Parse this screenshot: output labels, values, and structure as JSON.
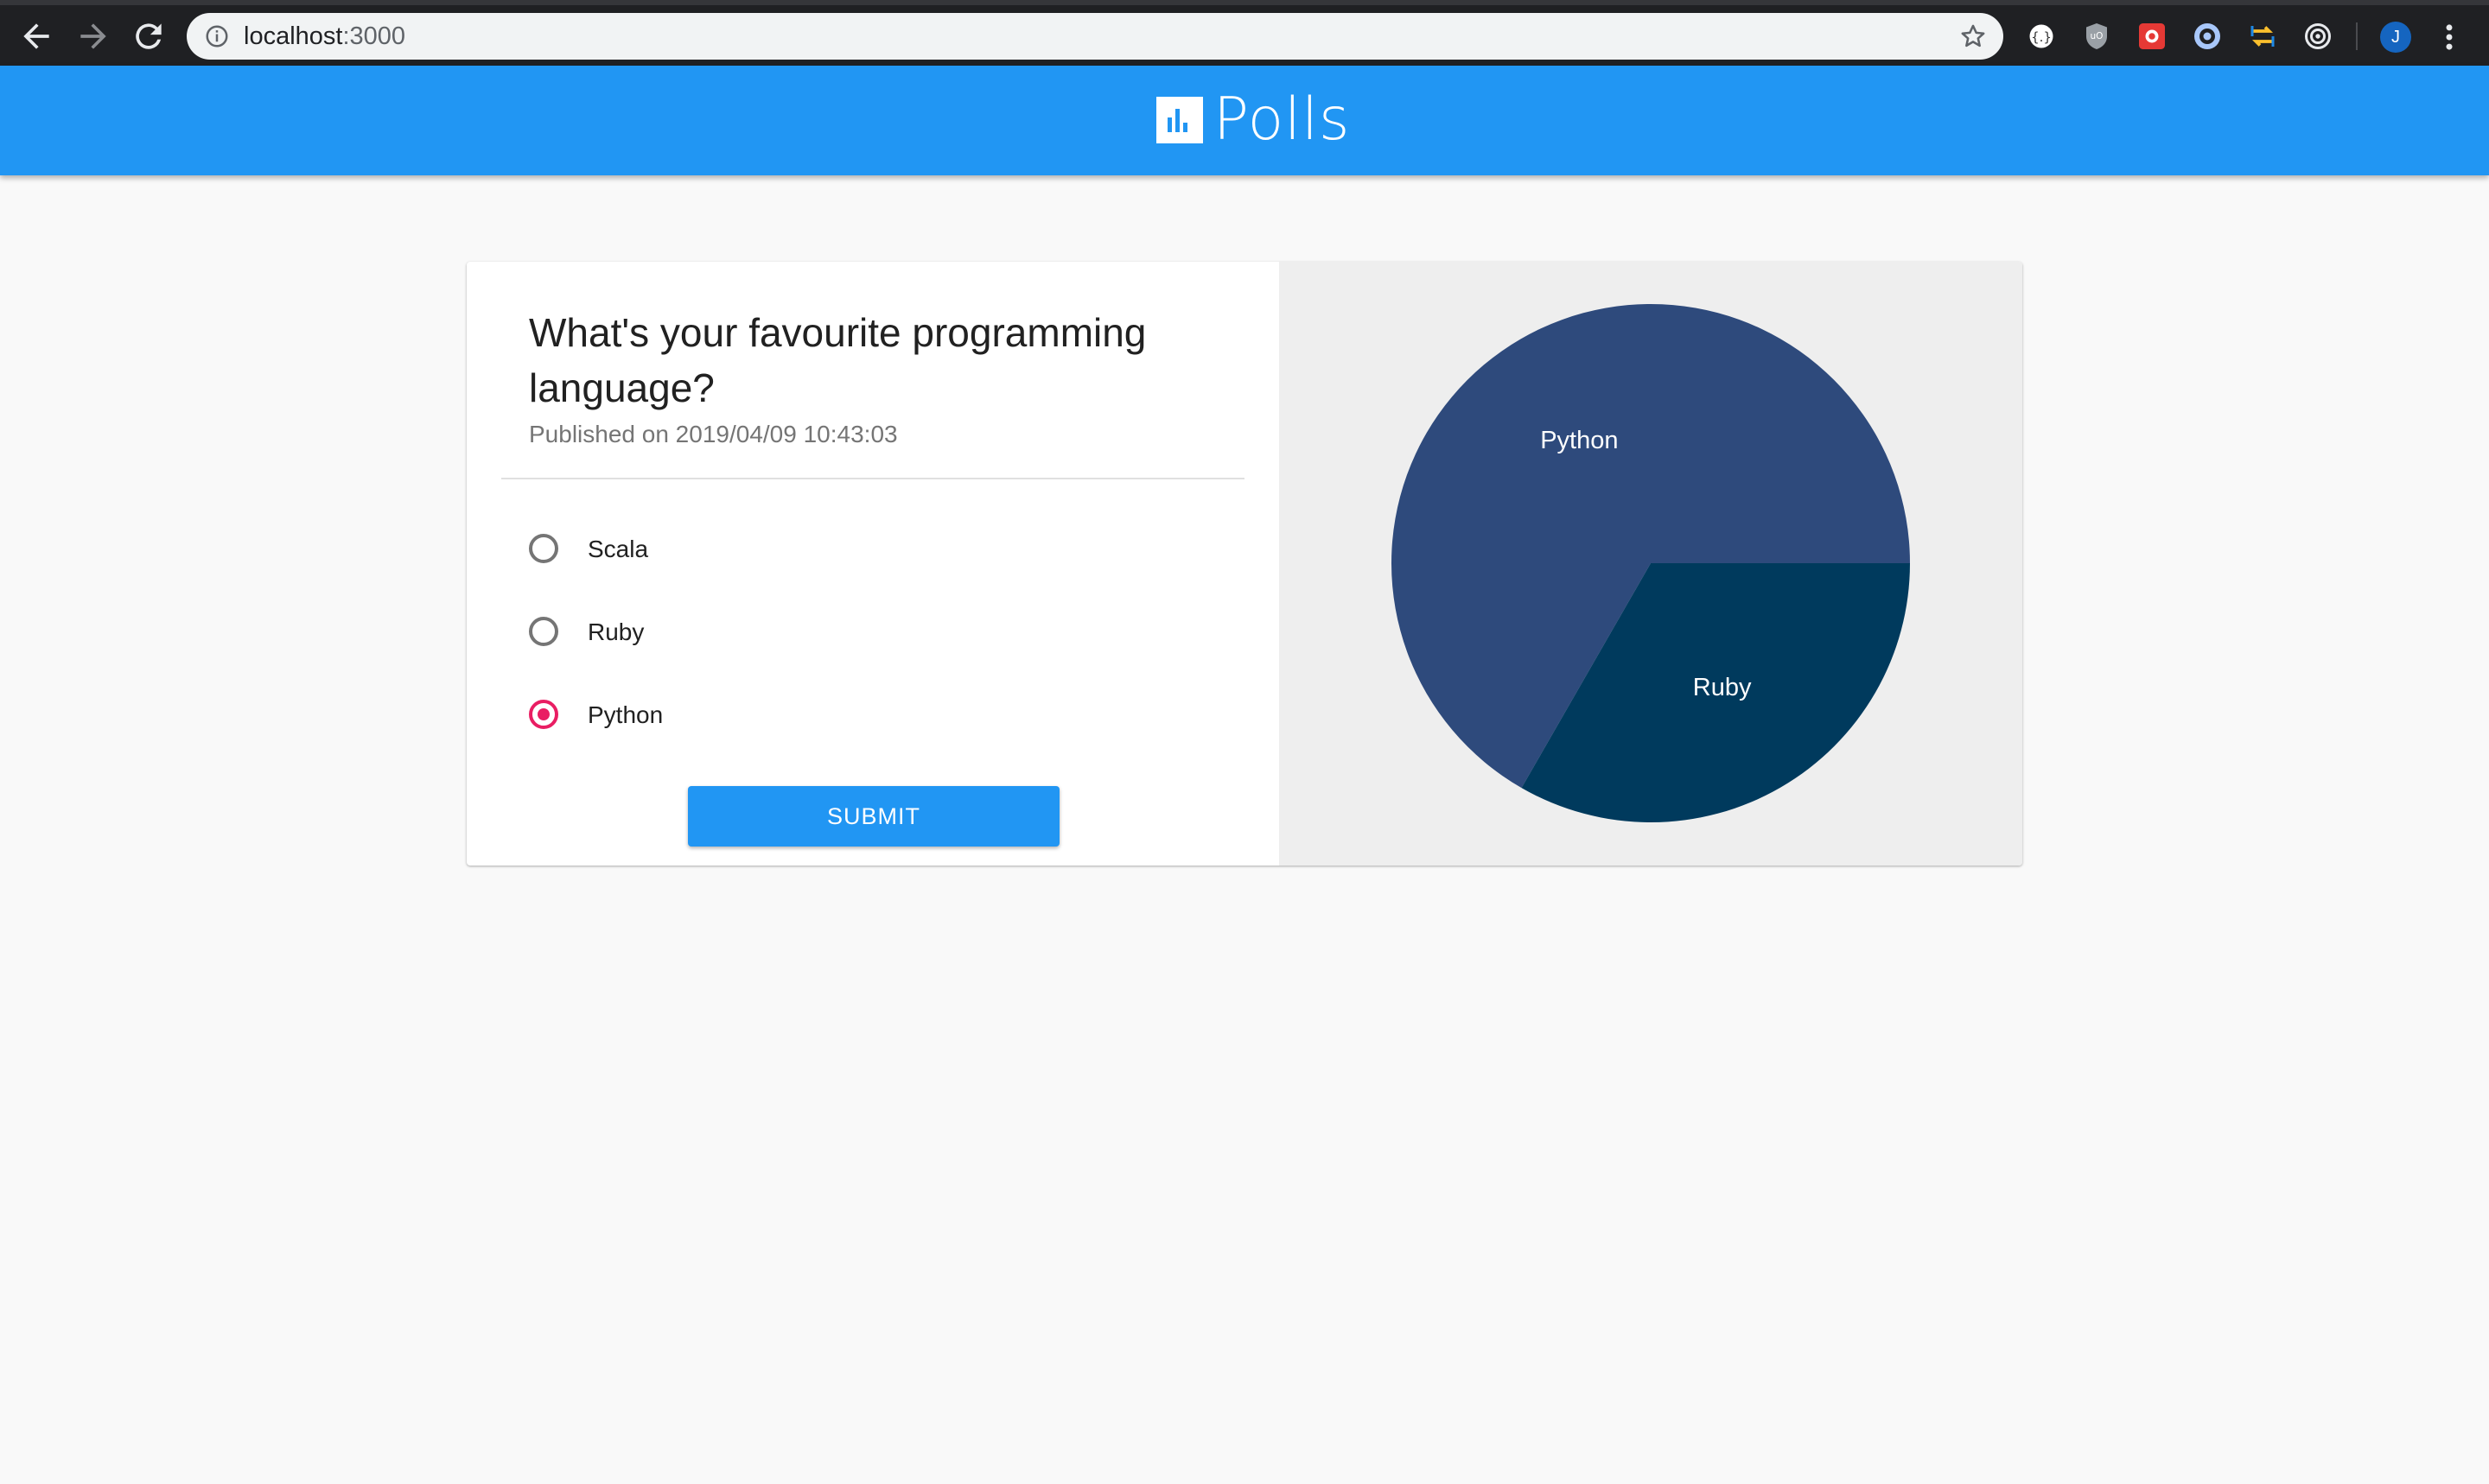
{
  "browser": {
    "url_host": "localhost",
    "url_port": ":3000",
    "avatar_letter": "J",
    "extensions": [
      "extension-icon",
      "ublock-icon",
      "extension-icon",
      "extension-icon",
      "extension-icon",
      "extension-icon"
    ]
  },
  "app": {
    "brand": "Polls"
  },
  "poll": {
    "question": "What's your favourite programming language?",
    "published": "Published on 2019/04/09 10:43:03",
    "options": [
      {
        "label": "Scala",
        "selected": false
      },
      {
        "label": "Ruby",
        "selected": false
      },
      {
        "label": "Python",
        "selected": true
      }
    ],
    "submit_label": "SUBMIT"
  },
  "chart_data": {
    "type": "pie",
    "title": "",
    "slices": [
      {
        "label": "Python",
        "value": 66.7,
        "color": "#2e4a7c"
      },
      {
        "label": "Ruby",
        "value": 33.3,
        "color": "#003a5d"
      }
    ]
  }
}
